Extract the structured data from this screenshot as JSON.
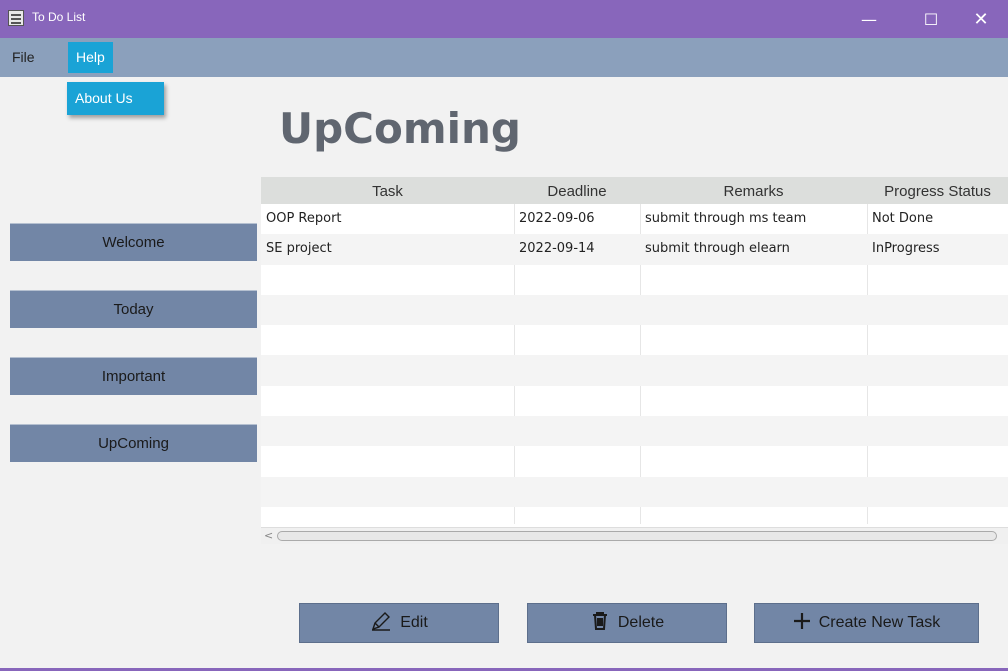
{
  "window": {
    "title": "To Do List",
    "minimize": "—",
    "maximize": "☐",
    "close": "✕"
  },
  "menu": {
    "file": "File",
    "help": "Help",
    "help_items": [
      "About Us"
    ]
  },
  "page": {
    "title": "UpComing"
  },
  "sidebar": {
    "items": [
      "Welcome",
      "Today",
      "Important",
      "UpComing"
    ]
  },
  "table": {
    "columns": [
      "Task",
      "Deadline",
      "Remarks",
      "Progress Status"
    ],
    "rows": [
      [
        "OOP Report",
        "2022-09-06",
        "submit through ms team",
        "Not Done"
      ],
      [
        "SE project",
        "2022-09-14",
        "submit through elearn",
        "InProgress"
      ]
    ]
  },
  "actions": {
    "edit": "Edit",
    "delete": "Delete",
    "create": "Create New Task"
  },
  "icons": {
    "edit": "pencil-icon",
    "delete": "trash-icon",
    "create": "plus-icon"
  },
  "colors": {
    "titlebar": "#8866bb",
    "menubar": "#8ba0bc",
    "accent": "#1aa3d6",
    "button": "#7286a6"
  }
}
